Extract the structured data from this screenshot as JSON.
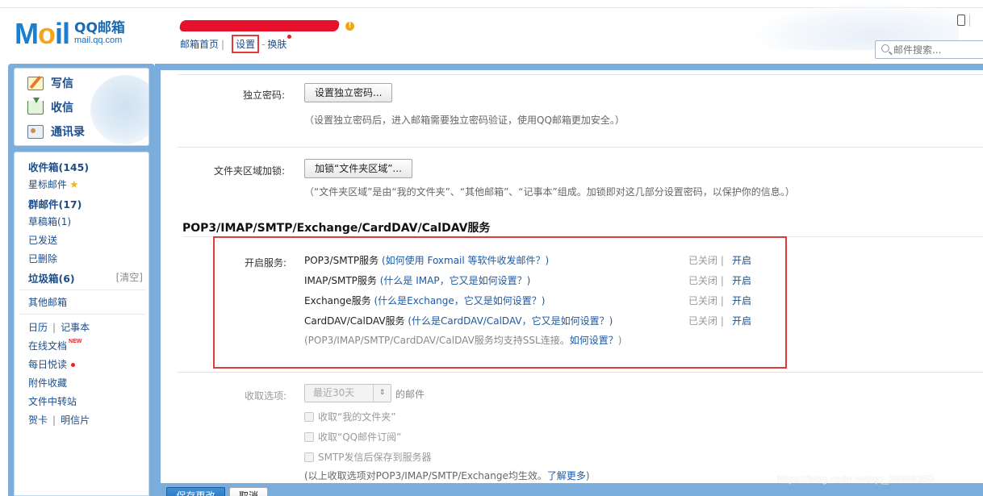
{
  "header": {
    "logo_mark": "M",
    "logo_mark_o": "il",
    "logo_cn": "QQ邮箱",
    "logo_en": "mail.qq.com",
    "nav": {
      "home": "邮箱首页",
      "settings": "设置",
      "skin": "换肤"
    },
    "search_placeholder": "邮件搜索..."
  },
  "sidebar": {
    "quick": {
      "write": "写信",
      "inbox": "收信",
      "contacts": "通讯录"
    },
    "folders": {
      "inbox": {
        "label": "收件箱",
        "count": "(145)"
      },
      "starred": "星标邮件",
      "group": {
        "label": "群邮件",
        "count": "(17)"
      },
      "drafts": {
        "label": "草稿箱",
        "count": "(1)"
      },
      "sent": "已发送",
      "deleted": "已删除",
      "spam": {
        "label": "垃圾箱",
        "count": "(6)"
      },
      "clear": "[清空]",
      "other_mailboxes": "其他邮箱",
      "calendar": "日历",
      "notes": "记事本",
      "docs": "在线文档",
      "docs_badge": "NEW",
      "daily": "每日悦读",
      "attachments": "附件收藏",
      "transfer": "文件中转站",
      "cards": "贺卡",
      "postcards": "明信片"
    }
  },
  "settings": {
    "independent_password": {
      "label": "独立密码:",
      "button": "设置独立密码...",
      "hint": "（设置独立密码后，进入邮箱需要独立密码验证，使用QQ邮箱更加安全。）"
    },
    "folder_lock": {
      "label": "文件夹区域加锁:",
      "button": "加锁“文件夹区域”...",
      "hint": "（“文件夹区域”是由“我的文件夹”、“其他邮箱”、“记事本”组成。加锁即对这几部分设置密码，以保护你的信息。）"
    },
    "services": {
      "title": "POP3/IMAP/SMTP/Exchange/CardDAV/CalDAV服务",
      "label": "开启服务:",
      "items": [
        {
          "name": "POP3/SMTP服务",
          "help": "(如何使用 Foxmail 等软件收发邮件？)",
          "status": "已关闭 |",
          "action": "开启"
        },
        {
          "name": "IMAP/SMTP服务",
          "help": "(什么是 IMAP，它又是如何设置？)",
          "status": "已关闭 |",
          "action": "开启"
        },
        {
          "name": "Exchange服务",
          "help": "(什么是Exchange，它又是如何设置？)",
          "status": "已关闭 |",
          "action": "开启"
        },
        {
          "name": "CardDAV/CalDAV服务",
          "help": "(什么是CardDAV/CalDAV，它又是如何设置？)",
          "status": "已关闭 |",
          "action": "开启"
        }
      ],
      "ssl_note_prefix": "(POP3/IMAP/SMTP/CardDAV/CalDAV服务均支持SSL连接。",
      "ssl_note_link": "如何设置？",
      "ssl_note_suffix": ")"
    },
    "fetch": {
      "label": "收取选项:",
      "select_value": "最近30天",
      "suffix": "的邮件",
      "options": [
        "收取“我的文件夹”",
        "收取“QQ邮件订阅”",
        "SMTP发信后保存到服务器"
      ],
      "note_prefix": "(以上收取选项对POP3/IMAP/SMTP/Exchange均生效。",
      "note_link": "了解更多",
      "note_suffix": ")"
    },
    "save_button": "保存更改",
    "cancel_button": "取消"
  },
  "watermark": "https://blog.csdn.net/qq_38889350",
  "colors": {
    "frame_blue": "#7aaddb",
    "link_blue": "#1c4d8a",
    "highlight_red": "#e13a3a"
  }
}
